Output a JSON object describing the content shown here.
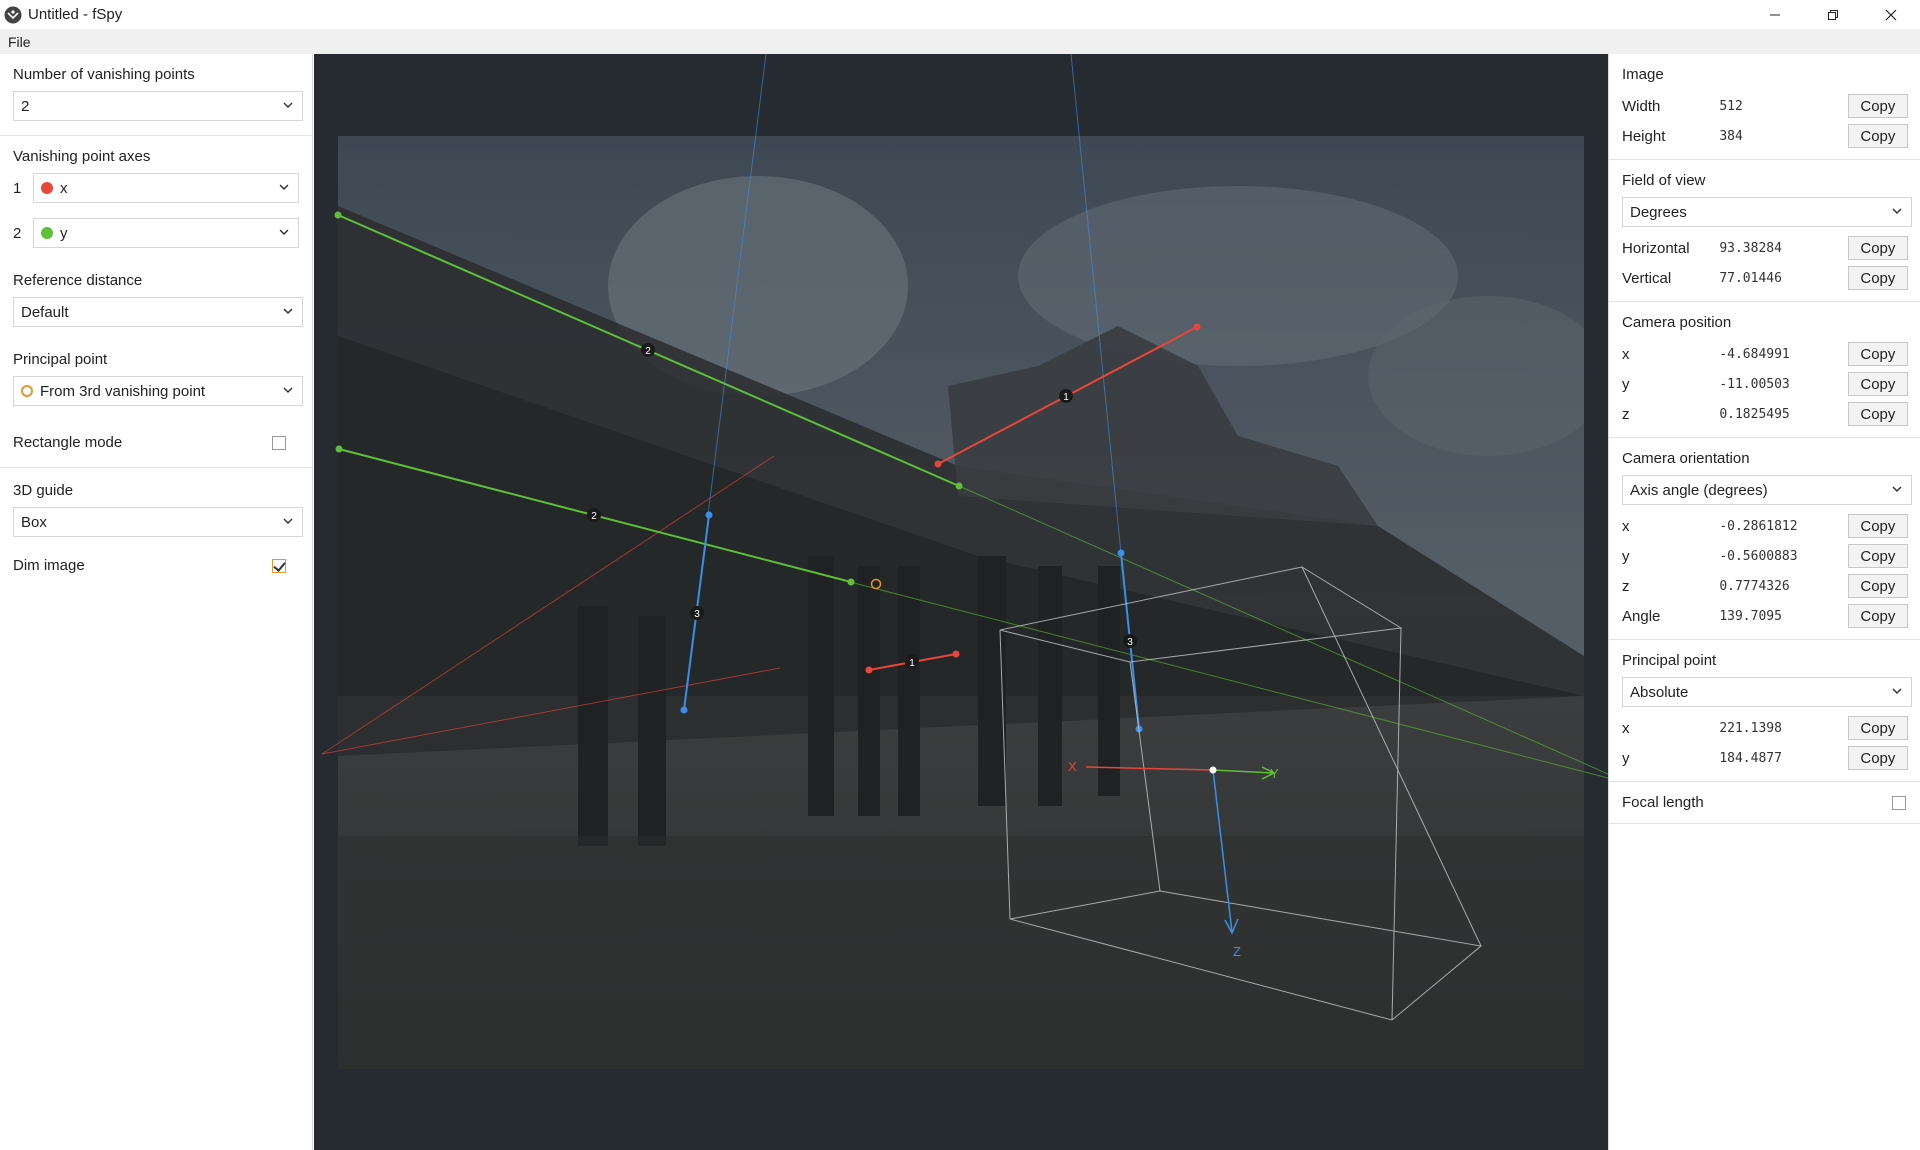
{
  "window": {
    "title": "Untitled - fSpy"
  },
  "menu": {
    "file": "File"
  },
  "left": {
    "num_vp_label": "Number of vanishing points",
    "num_vp_value": "2",
    "vp_axes_label": "Vanishing point axes",
    "vp_axes": [
      {
        "index": "1",
        "axis": "x",
        "color": "#e8453c"
      },
      {
        "index": "2",
        "axis": "y",
        "color": "#5fbf3b"
      }
    ],
    "ref_distance_label": "Reference distance",
    "ref_distance_value": "Default",
    "principal_point_label": "Principal point",
    "principal_point_value": "From 3rd vanishing point",
    "rectangle_mode_label": "Rectangle mode",
    "guide_label": "3D guide",
    "guide_value": "Box",
    "dim_image_label": "Dim image"
  },
  "canvas": {
    "handle_labels": [
      "1",
      "1",
      "2",
      "2",
      "3",
      "3"
    ],
    "axis_labels": {
      "x": "X",
      "y": "Y",
      "z": "Z"
    },
    "colors": {
      "x": "#e8453c",
      "y": "#5fbf3b",
      "z": "#3b8fe8",
      "principal": "#e8962e",
      "guide": "#c8c8c8"
    }
  },
  "right": {
    "copy_label": "Copy",
    "image": {
      "title": "Image",
      "width_label": "Width",
      "width": "512",
      "height_label": "Height",
      "height": "384"
    },
    "fov": {
      "title": "Field of view",
      "unit": "Degrees",
      "horizontal_label": "Horizontal",
      "horizontal": "93.38284",
      "vertical_label": "Vertical",
      "vertical": "77.01446"
    },
    "camera_position": {
      "title": "Camera position",
      "x_label": "x",
      "x": "-4.684991",
      "y_label": "y",
      "y": "-11.00503",
      "z_label": "z",
      "z": "0.1825495"
    },
    "camera_orientation": {
      "title": "Camera orientation",
      "mode": "Axis angle (degrees)",
      "x_label": "x",
      "x": "-0.2861812",
      "y_label": "y",
      "y": "-0.5600883",
      "z_label": "z",
      "z": "0.7774326",
      "angle_label": "Angle",
      "angle": "139.7095"
    },
    "principal_point": {
      "title": "Principal point",
      "mode": "Absolute",
      "x_label": "x",
      "x": "221.1398",
      "y_label": "y",
      "y": "184.4877"
    },
    "focal_length_label": "Focal length"
  }
}
